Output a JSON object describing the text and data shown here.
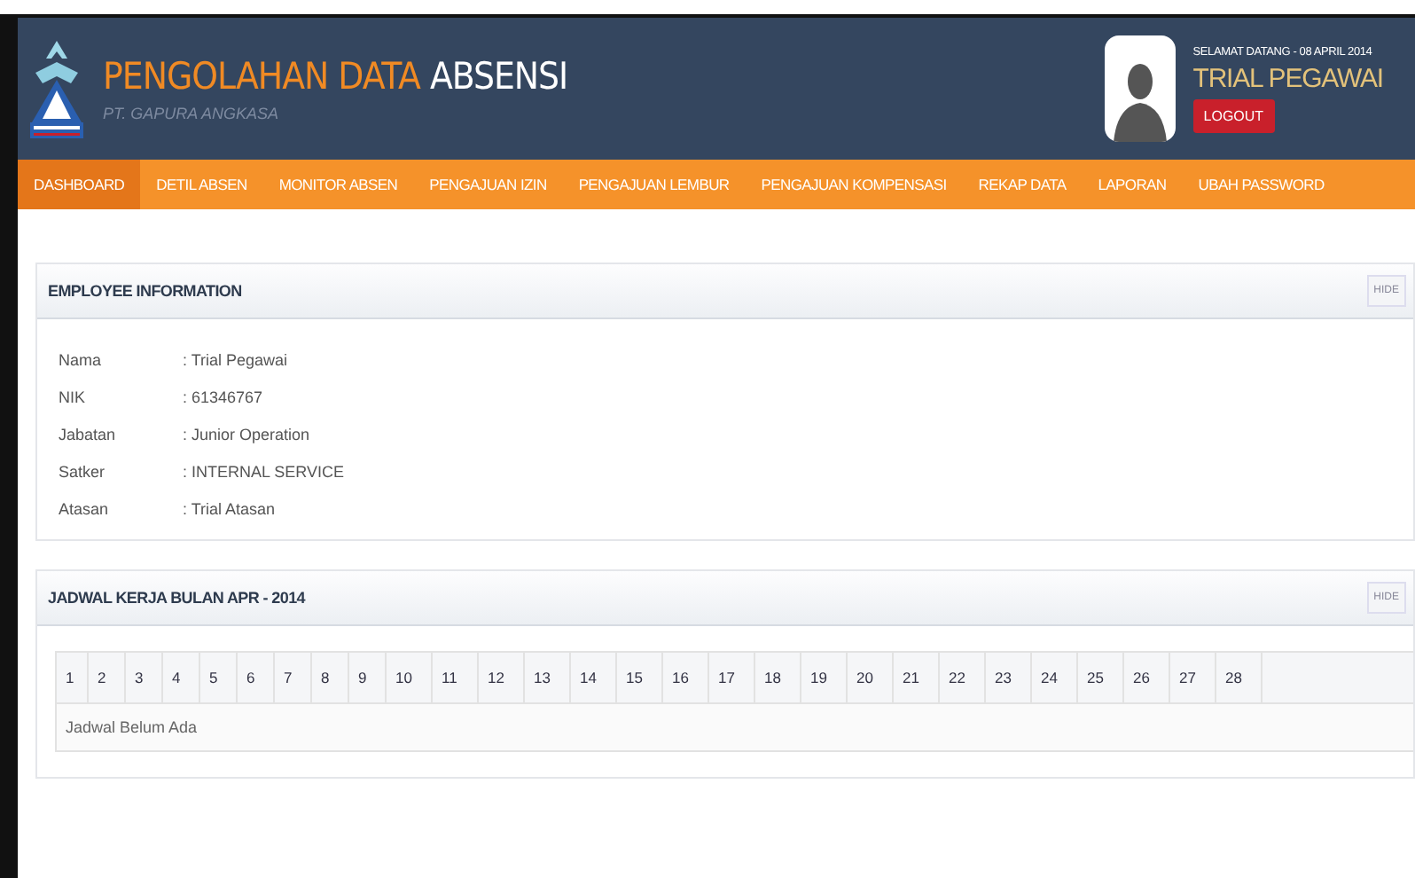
{
  "header": {
    "title_accent": "PENGOLAHAN DATA",
    "title_main": "ABSENSI",
    "subtitle": "PT. GAPURA ANGKASA",
    "greeting": "SELAMAT DATANG - 08 APRIL 2014",
    "user_name": "TRIAL PEGAWAI",
    "logout": "LOGOUT"
  },
  "nav": [
    {
      "label": "DASHBOARD",
      "selected": true
    },
    {
      "label": "DETIL ABSEN",
      "selected": false
    },
    {
      "label": "MONITOR ABSEN",
      "selected": false
    },
    {
      "label": "PENGAJUAN IZIN",
      "selected": false
    },
    {
      "label": "PENGAJUAN LEMBUR",
      "selected": false
    },
    {
      "label": "PENGAJUAN KOMPENSASI",
      "selected": false
    },
    {
      "label": "REKAP DATA",
      "selected": false
    },
    {
      "label": "LAPORAN",
      "selected": false
    },
    {
      "label": "UBAH PASSWORD",
      "selected": false
    }
  ],
  "employee_panel": {
    "title": "EMPLOYEE INFORMATION",
    "hide": "HIDE",
    "fields": [
      {
        "label": "Nama",
        "value": ": Trial Pegawai"
      },
      {
        "label": "NIK",
        "value": ": 61346767"
      },
      {
        "label": "Jabatan",
        "value": ": Junior Operation"
      },
      {
        "label": "Satker",
        "value": ": INTERNAL SERVICE"
      },
      {
        "label": "Atasan",
        "value": ": Trial Atasan"
      }
    ]
  },
  "schedule_panel": {
    "title": "JADWAL KERJA BULAN APR - 2014",
    "hide": "HIDE",
    "days": [
      "1",
      "2",
      "3",
      "4",
      "5",
      "6",
      "7",
      "8",
      "9",
      "10",
      "11",
      "12",
      "13",
      "14",
      "15",
      "16",
      "17",
      "18",
      "19",
      "20",
      "21",
      "22",
      "23",
      "24",
      "25",
      "26",
      "27",
      "28"
    ],
    "empty_message": "Jadwal Belum Ada"
  }
}
